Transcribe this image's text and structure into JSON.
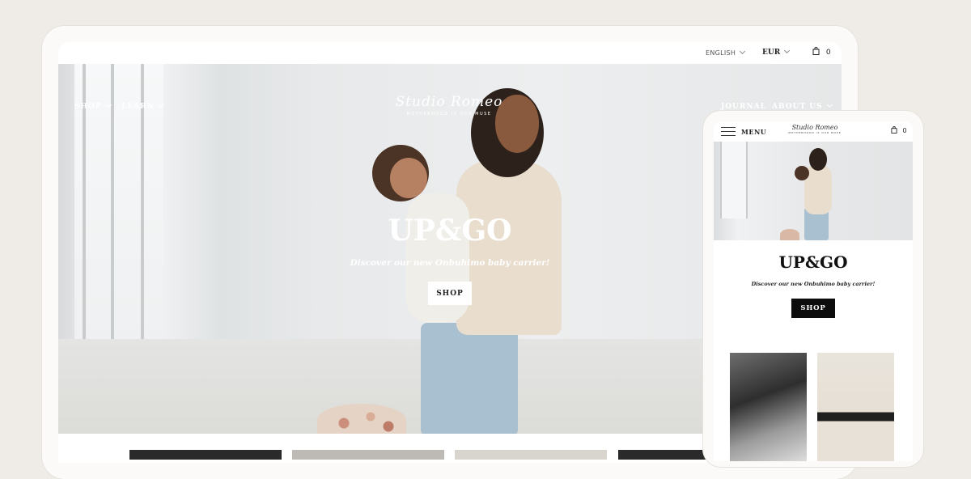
{
  "desktop": {
    "utility": {
      "language": "ENGLISH",
      "currency": "EUR",
      "cart_count": "0"
    },
    "nav": {
      "shop": "SHOP",
      "learn": "LEARN",
      "journal": "JOURNAL",
      "about": "ABOUT US"
    },
    "logo": {
      "script": "Studio Romeo",
      "tagline": "MOTHERHOOD IS OUR MUSE"
    },
    "hero": {
      "title": "UP&GO",
      "subtitle": "Discover our new Onbuhimo baby carrier!",
      "button": "SHOP"
    }
  },
  "mobile": {
    "menu_label": "MENU",
    "logo": {
      "script": "Studio Romeo",
      "tagline": "MOTHERHOOD IS OUR MUSE"
    },
    "cart_count": "0",
    "hero": {
      "title": "UP&GO",
      "subtitle": "Discover our new Onbuhimo baby carrier!",
      "button": "SHOP"
    }
  }
}
